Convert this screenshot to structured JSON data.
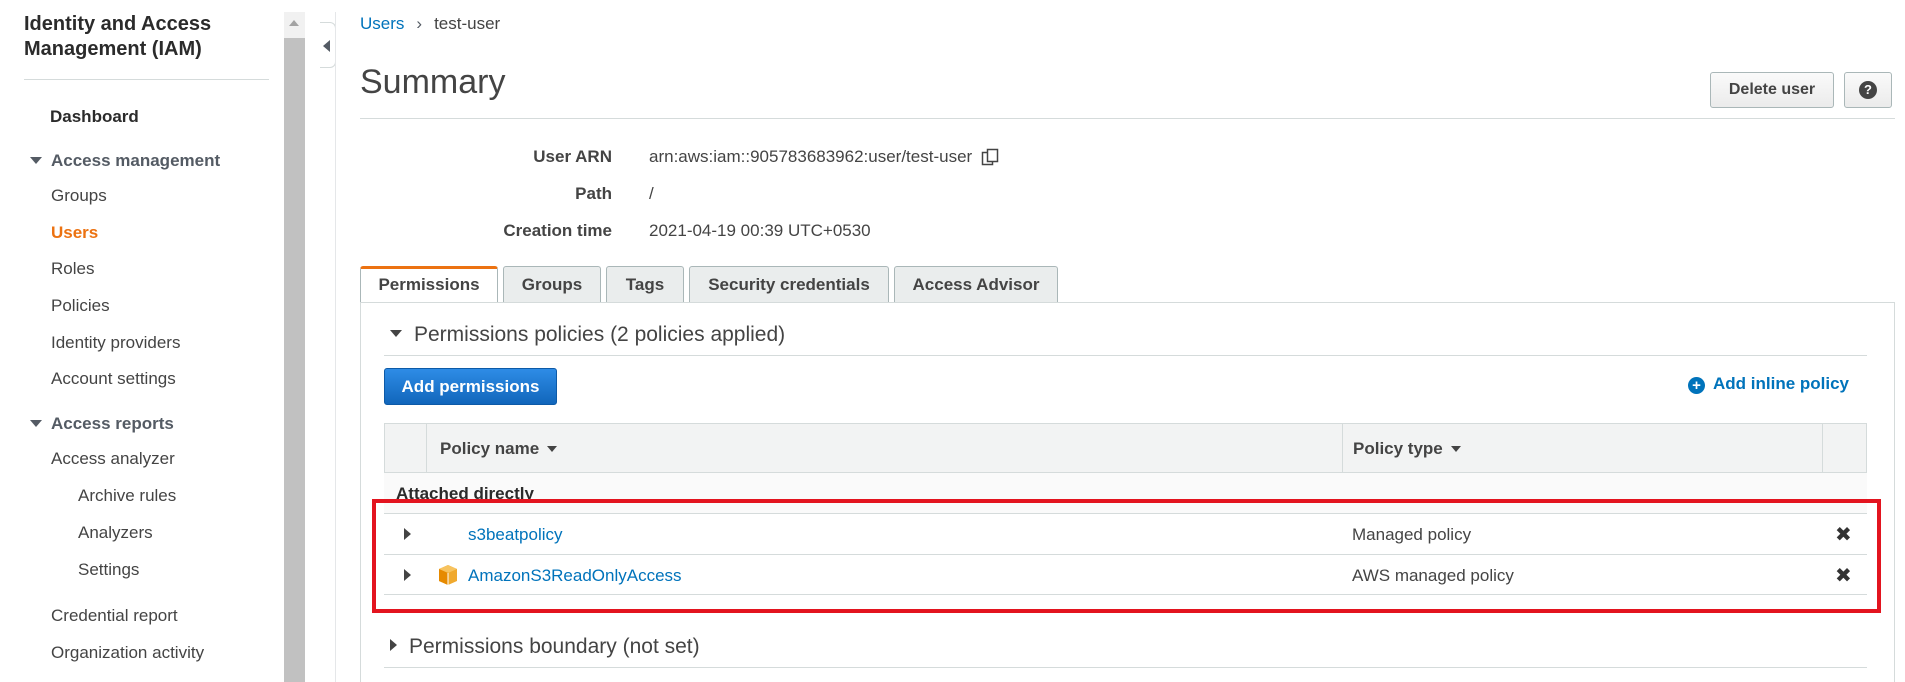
{
  "sidebar": {
    "title": "Identity and Access Management (IAM)",
    "dashboard": "Dashboard",
    "access_management": {
      "label": "Access management",
      "items": [
        "Groups",
        "Users",
        "Roles",
        "Policies",
        "Identity providers",
        "Account settings"
      ],
      "active": "Users"
    },
    "access_reports": {
      "label": "Access reports",
      "access_analyzer": "Access analyzer",
      "sub_items": [
        "Archive rules",
        "Analyzers",
        "Settings"
      ],
      "credential_report": "Credential report",
      "organization_activity": "Organization activity"
    }
  },
  "breadcrumb": {
    "parent": "Users",
    "current": "test-user"
  },
  "page": {
    "title": "Summary",
    "delete_label": "Delete user",
    "help_glyph": "?"
  },
  "summary": {
    "arn_label": "User ARN",
    "arn_value": "arn:aws:iam::905783683962:user/test-user",
    "path_label": "Path",
    "path_value": "/",
    "creation_label": "Creation time",
    "creation_value": "2021-04-19 00:39 UTC+0530"
  },
  "tabs": [
    "Permissions",
    "Groups",
    "Tags",
    "Security credentials",
    "Access Advisor"
  ],
  "active_tab": "Permissions",
  "permissions": {
    "section_title": "Permissions policies (2 policies applied)",
    "add_permissions": "Add permissions",
    "add_inline_policy": "Add inline policy",
    "columns": {
      "name": "Policy name",
      "type": "Policy type"
    },
    "group_label": "Attached directly",
    "rows": [
      {
        "name": "s3beatpolicy",
        "type": "Managed policy",
        "icon": "none"
      },
      {
        "name": "AmazonS3ReadOnlyAccess",
        "type": "AWS managed policy",
        "icon": "aws-box-icon"
      }
    ],
    "boundary_title": "Permissions boundary (not set)"
  },
  "colors": {
    "accent": "#ec7211",
    "link": "#0073bb",
    "primary": "#1166bb",
    "highlight": "#e3141f"
  }
}
